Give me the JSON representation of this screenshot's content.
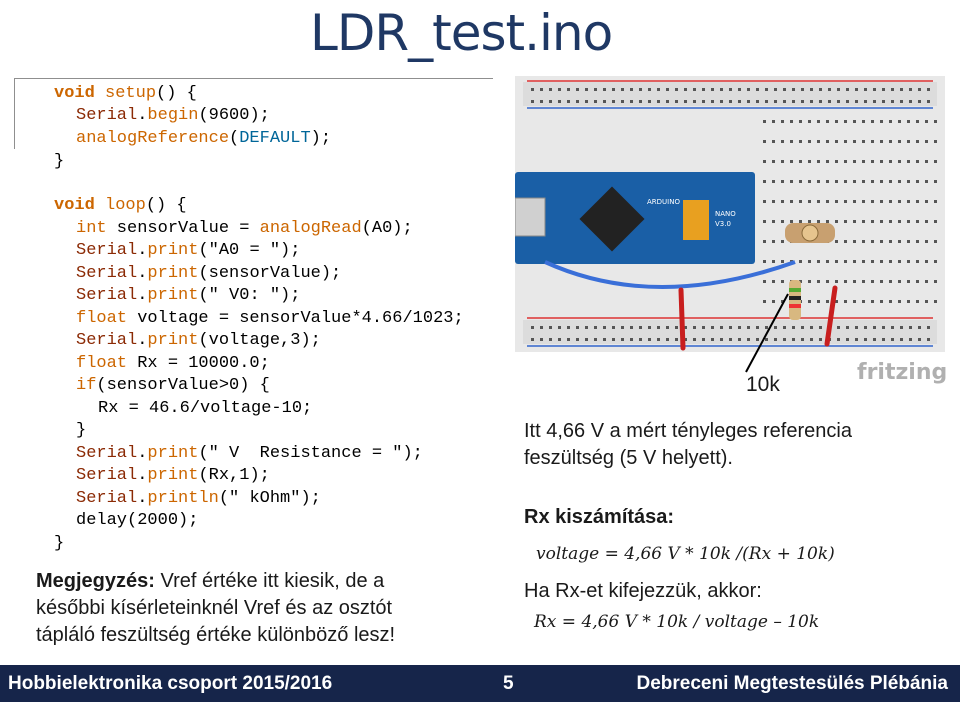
{
  "title": "LDR_test.ino",
  "code": {
    "setup_open": "void setup() {",
    "begin_line": "Serial.begin(9600);",
    "aref_line": "analogReference(DEFAULT);",
    "close1": "}",
    "loop_open": "void loop() {",
    "sensor_line": "int sensorValue = analogRead(A0);",
    "print_a0": "Serial.print(\"A0 = \");",
    "print_sv": "Serial.print(sensorValue);",
    "print_v0": "Serial.print(\" V0: \");",
    "voltage_line": "float voltage = sensorValue*4.66/1023;",
    "print_volt": "Serial.print(voltage,3);",
    "rx_decl": "float Rx = 10000.0;",
    "if_line": "if(sensorValue>0) {",
    "rx_calc": "Rx = 46.6/voltage-10;",
    "close_if": "}",
    "print_res": "Serial.print(\" V  Resistance = \");",
    "print_rx": "Serial.print(Rx,1);",
    "println_kohm": "Serial.println(\" kOhm\");",
    "delay_line": "delay(2000);",
    "close2": "}"
  },
  "note": {
    "label": "Megjegyzés:",
    "line1": " Vref értéke itt kiesik, de a",
    "line2": "későbbi kísérleteinknél Vref és az osztót",
    "line3": "tápláló feszültség értéke különböző lesz!"
  },
  "diagram": {
    "resistor_label": "10k",
    "brand": "fritzing",
    "board_text_1": "ARDUINO",
    "board_text_2": "NANO",
    "board_text_3": "V3.0"
  },
  "right": {
    "line1": "Itt  4,66 V a mért tényleges referencia",
    "line2": "feszültség (5 V helyett).",
    "calc_heading": "Rx kiszámítása:",
    "formula1": "voltage = 4,66 V * 10k /(Rx + 10k)",
    "expr_line": "Ha Rx-et kifejezzük, akkor:",
    "formula2": "Rx = 4,66 V * 10k / voltage – 10k"
  },
  "footer": {
    "left": "Hobbielektronika csoport 2015/2016",
    "page": "5",
    "right": "Debreceni Megtestesülés Plébánia"
  },
  "colors": {
    "title": "#1f3864",
    "footer_bg": "#16254a",
    "keyword": "#cc6600",
    "arduino_blue": "#1a5fa6"
  }
}
